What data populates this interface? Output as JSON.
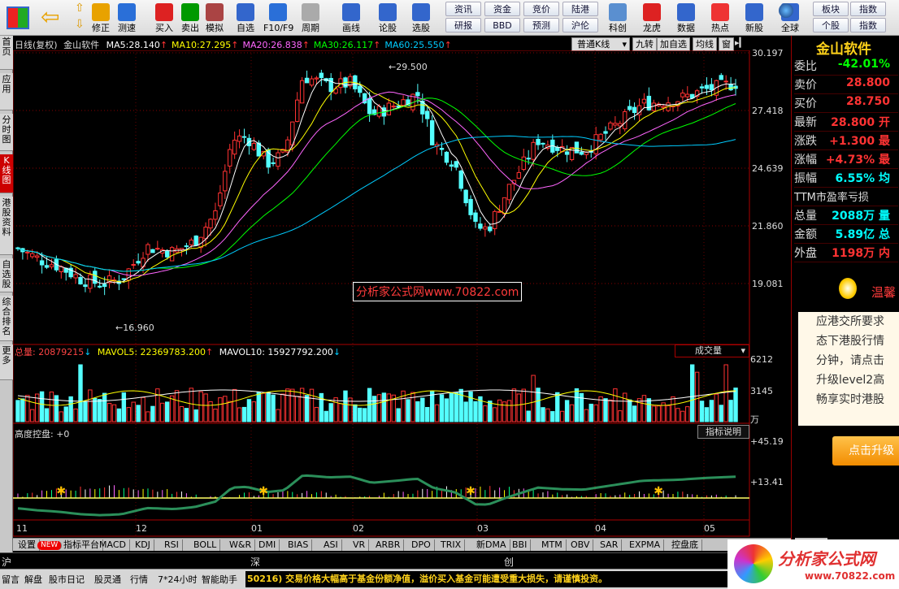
{
  "toolbar": {
    "buttons": [
      "修正",
      "测速",
      "买入",
      "卖出",
      "模拟",
      "自选",
      "F10/F9",
      "周期",
      "画线",
      "论股",
      "选股",
      "科创",
      "龙虎",
      "数据",
      "热点",
      "新股",
      "全球"
    ],
    "small_buttons": [
      "资讯",
      "资金",
      "竞价",
      "陆港",
      "研报",
      "BBD",
      "预测",
      "沪伦",
      "板块",
      "指数",
      "个股",
      "指数"
    ]
  },
  "left_tabs": [
    "首页",
    "应用",
    "分时图",
    "K线图",
    "港股资料",
    "自选股",
    "综合排名",
    "更多"
  ],
  "chart": {
    "title": "日线(复权)",
    "stock_name": "金山软件",
    "ma": [
      {
        "label": "MA5:",
        "value": "28.140",
        "color": "#ffffff"
      },
      {
        "label": "MA10:",
        "value": "27.295",
        "color": "#ffff00"
      },
      {
        "label": "MA20:",
        "value": "26.838",
        "color": "#ff66ff"
      },
      {
        "label": "MA30:",
        "value": "26.117",
        "color": "#00ff00"
      },
      {
        "label": "MA60:",
        "value": "25.550",
        "color": "#00ccff"
      }
    ],
    "arrow": "↑",
    "dropdown_kline": "普通K线",
    "tabs": [
      "九转",
      "加自选",
      "均线",
      "窗"
    ],
    "y_ticks": [
      "30.197",
      "27.418",
      "24.639",
      "21.860",
      "19.081"
    ],
    "high_label": "29.500",
    "low_label": "16.960",
    "watermark": "分析家公式网www.70822.com",
    "x_ticks": [
      "11",
      "12",
      "01",
      "02",
      "03",
      "04",
      "05"
    ]
  },
  "volume": {
    "total_label": "总量: 20879215",
    "mavol5": "MAVOL5: 22369783.200",
    "mavol10": "MAVOL10: 15927792.200",
    "arrow": "↓",
    "dropdown": "成交量",
    "y_ticks": [
      "6212",
      "3145"
    ],
    "unit": "万"
  },
  "indicator": {
    "name": "高度控盘: +0",
    "button": "指标说明",
    "y_ticks": [
      "+45.19",
      "+13.41"
    ]
  },
  "quote": {
    "name": "金山软件",
    "rows": [
      {
        "k": "委比",
        "v": "-42.01%",
        "c": "#00ff00"
      },
      {
        "k": "卖价",
        "v": "28.800",
        "c": "#ff3333"
      },
      {
        "k": "买价",
        "v": "28.750",
        "c": "#ff3333"
      },
      {
        "k": "最新",
        "v": "28.800 开",
        "c": "#ff3333"
      },
      {
        "k": "涨跌",
        "v": "+1.300 最",
        "c": "#ff3333"
      },
      {
        "k": "涨幅",
        "v": "+4.73% 最",
        "c": "#ff3333"
      },
      {
        "k": "振幅",
        "v": "6.55% 均",
        "c": "#00ffff"
      },
      {
        "k": "TTM市盈率亏损",
        "v": "市",
        "c": "#dddddd"
      },
      {
        "k": "总量",
        "v": "2088万 量",
        "c": "#00ffff"
      },
      {
        "k": "金额",
        "v": "5.89亿 总",
        "c": "#00ffff"
      },
      {
        "k": "外盘",
        "v": "1198万 内",
        "c": "#ff3333"
      }
    ],
    "notice_title": "温馨",
    "notice_text": [
      "应港交所要求",
      "态下港股行情",
      "分钟，请点击",
      "升级level2高",
      "畅享实时港股"
    ],
    "upgrade": "点击升级"
  },
  "bottom_tabs": [
    "设置",
    "NEW",
    "指标平台",
    "MACD",
    "KDJ",
    "RSI",
    "BOLL",
    "W&R",
    "DMI",
    "BIAS",
    "ASI",
    "VR",
    "ARBR",
    "DPO",
    "TRIX",
    "新DMA",
    "BBI",
    "MTM",
    "OBV",
    "SAR",
    "EXPMA",
    "控盘底"
  ],
  "bottom_tab_right": "沪",
  "status": {
    "row1": [
      "沪",
      "深",
      "创"
    ],
    "items": [
      "留言",
      "解盘",
      "股市日记",
      "股灵通",
      "行情",
      "7*24小时",
      "智能助手"
    ],
    "ticker": "50216) 交易价格大幅高于基金份额净值，溢价买入基金可能遭受重大损失，请谨慎投资。",
    "logo_text": "分析家公式网",
    "logo_url": "www.70822.com"
  }
}
